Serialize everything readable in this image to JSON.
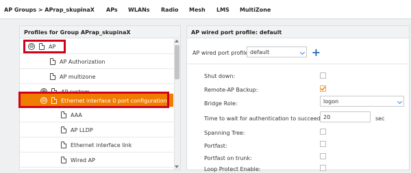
{
  "nav": {
    "breadcrumb": "AP Groups > APrap_skupinaX",
    "tabs": [
      "APs",
      "WLANs",
      "Radio",
      "Mesh",
      "LMS",
      "MultiZone"
    ]
  },
  "left_panel": {
    "title": "Profiles for Group APrap_skupinaX",
    "items": [
      {
        "label": "AP",
        "toggle": "⊖"
      },
      {
        "label": "AP Authorization"
      },
      {
        "label": "AP multizone"
      },
      {
        "label": "AP system",
        "toggle": "⊕"
      },
      {
        "label": "Ethernet interface 0 port configuration",
        "toggle": "⊖"
      },
      {
        "label": "AAA"
      },
      {
        "label": "AP LLDP"
      },
      {
        "label": "Ethernet interface link"
      },
      {
        "label": "Wired AP"
      }
    ]
  },
  "right_panel": {
    "title": "AP wired port profile: default",
    "profile_label": "AP wired port profile:",
    "profile_value": "default",
    "add_symbol": "+",
    "fields": {
      "shutdown": "Shut down:",
      "remote_backup": "Remote-AP Backup:",
      "bridge_role": "Bridge Role:",
      "bridge_role_value": "logon",
      "auth_wait": "Time to wait for authentication to succeed:",
      "auth_wait_value": "20",
      "auth_wait_unit": "sec",
      "spanning_tree": "Spanning Tree:",
      "portfast": "Portfast:",
      "portfast_trunk": "Portfast on trunk:",
      "loop_protect": "Loop Protect Enable:"
    }
  },
  "colors": {
    "selected_row": "#f07c00",
    "highlight_box": "#d0021b",
    "accent": "#2a6fb8",
    "check": "#f07c00"
  }
}
